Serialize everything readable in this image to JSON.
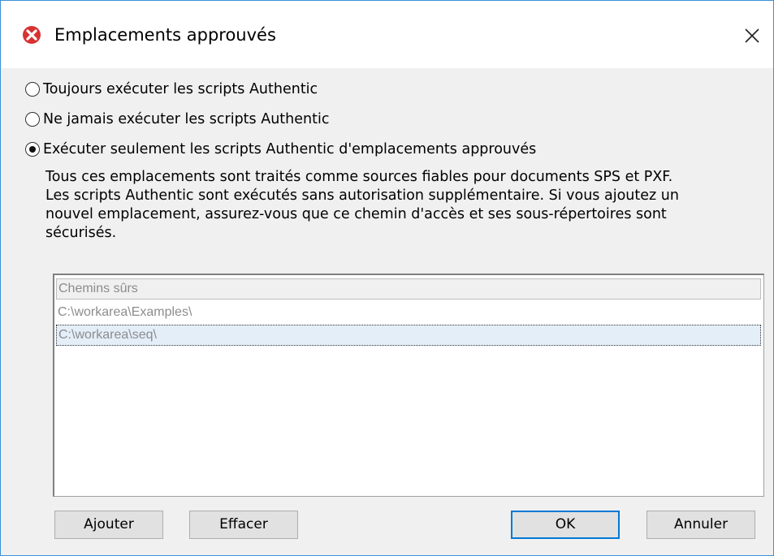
{
  "window": {
    "title": "Emplacements approuvés",
    "accent_color": "#3c8fd8"
  },
  "options": [
    {
      "label": "Toujours exécuter les scripts Authentic",
      "checked": false
    },
    {
      "label": "Ne jamais exécuter les scripts Authentic",
      "checked": false
    },
    {
      "label": "Exécuter seulement les scripts Authentic d'emplacements approuvés",
      "checked": true
    }
  ],
  "description": [
    "Tous ces emplacements sont traités comme sources fiables pour documents SPS et PXF.",
    "Les scripts Authentic sont exécutés sans autorisation supplémentaire. Si vous ajoutez un",
    "nouvel emplacement, assurez-vous que ce chemin d'accès et ses sous-répertoires sont",
    "sécurisés."
  ],
  "paths_list": {
    "header": "Chemins sûrs",
    "rows": [
      "C:\\workarea\\Examples\\",
      "C:\\workarea\\seq\\"
    ],
    "selected_index": 1
  },
  "buttons": {
    "add": "Ajouter",
    "clear": "Effacer",
    "ok": "OK",
    "cancel": "Annuler"
  }
}
